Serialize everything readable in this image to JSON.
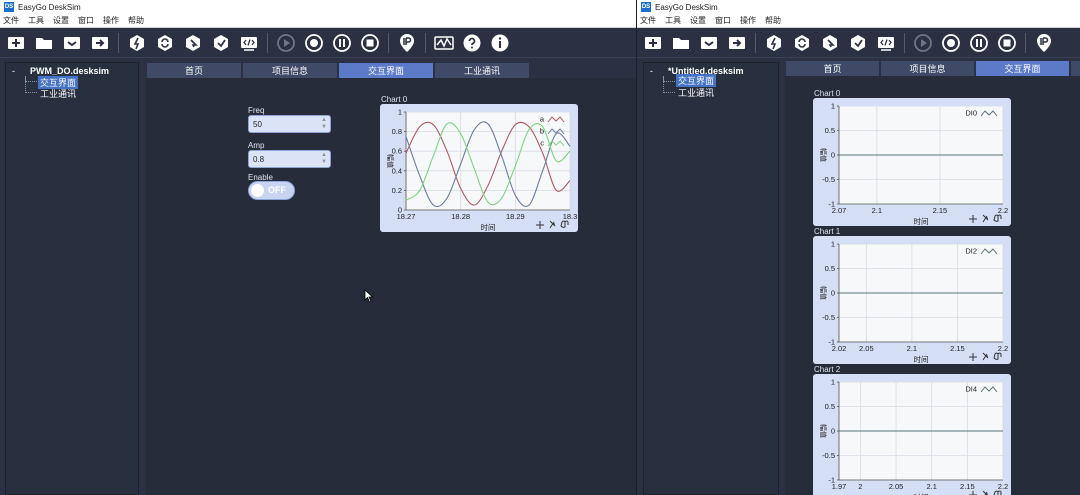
{
  "left": {
    "title": "EasyGo DeskSim",
    "app_icon": "DS",
    "menu": [
      "文件",
      "工具",
      "设置",
      "窗口",
      "操作",
      "帮助"
    ],
    "tree": {
      "root": "PWM_DO.desksim",
      "minus": "-",
      "items": [
        "交互界面",
        "工业通讯"
      ]
    },
    "tabs": [
      "首页",
      "项目信息",
      "交互界面",
      "工业通讯"
    ],
    "freq": {
      "label": "Freq",
      "value": "50"
    },
    "amp": {
      "label": "Amp",
      "value": "0.8"
    },
    "enable": {
      "label": "Enable",
      "state": "OFF"
    },
    "chart_caption": "Chart 0"
  },
  "right": {
    "title": "EasyGo DeskSim",
    "app_icon": "DS",
    "menu": [
      "文件",
      "工具",
      "设置",
      "窗口",
      "操作",
      "帮助"
    ],
    "tree": {
      "root": "*Untitled.desksim",
      "minus": "-",
      "items": [
        "交互界面",
        "工业通讯"
      ]
    },
    "tabs": [
      "首页",
      "项目信息",
      "交互界面"
    ],
    "chart_captions": [
      "Chart 0",
      "Chart 1",
      "Chart 2"
    ]
  },
  "colors": {
    "accent": "#5b7bc8",
    "series_a": "#b05a63",
    "series_b": "#6b7e9e",
    "series_c": "#7cd67c",
    "trace": "#5a7478"
  },
  "icons": [
    "new-icon",
    "open-icon",
    "save-icon",
    "export-icon",
    "build-icon",
    "refresh-icon",
    "download-icon",
    "deploy-icon",
    "code-icon",
    "play-icon",
    "record-icon",
    "pause-icon",
    "stop-icon",
    "ip-icon",
    "scope-icon",
    "help-icon",
    "info-icon"
  ],
  "chart_data": [
    {
      "type": "line",
      "title": "Chart 0",
      "xlabel": "时间",
      "ylabel": "幅值",
      "x": [
        18.27,
        18.2725,
        18.275,
        18.2775,
        18.28,
        18.2825,
        18.285,
        18.2875,
        18.29,
        18.2925,
        18.295,
        18.2975,
        18.3
      ],
      "series": [
        {
          "name": "a",
          "values": [
            0.58,
            0.85,
            0.87,
            0.6,
            0.22,
            0.05,
            0.25,
            0.6,
            0.87,
            0.85,
            0.58,
            0.2,
            0.3
          ]
        },
        {
          "name": "b",
          "values": [
            0.75,
            0.35,
            0.05,
            0.12,
            0.47,
            0.82,
            0.88,
            0.55,
            0.15,
            0.05,
            0.4,
            0.78,
            0.65
          ]
        },
        {
          "name": "c",
          "values": [
            0.1,
            0.2,
            0.55,
            0.88,
            0.78,
            0.42,
            0.08,
            0.12,
            0.45,
            0.82,
            0.85,
            0.5,
            0.6
          ]
        }
      ],
      "xticks": [
        "18.27",
        "18.28",
        "18.29",
        "18.3"
      ],
      "yticks": [
        "0",
        "0.2",
        "0.4",
        "0.6",
        "0.8",
        "1"
      ],
      "xlim": [
        18.27,
        18.3
      ],
      "ylim": [
        0,
        1
      ],
      "grid": true,
      "legend": "top-right"
    },
    {
      "type": "line",
      "title": "Chart 0",
      "xlabel": "时间",
      "ylabel": "幅值",
      "x": [
        2.07,
        2.2
      ],
      "series": [
        {
          "name": "DI0",
          "values": [
            0,
            0
          ]
        }
      ],
      "xticks": [
        "2.07",
        "2.1",
        "2.15",
        "2.2"
      ],
      "yticks": [
        "-1",
        "-0.5",
        "0",
        "0.5",
        "1"
      ],
      "xlim": [
        2.07,
        2.2
      ],
      "ylim": [
        -1,
        1
      ],
      "grid": true,
      "legend": "top-right"
    },
    {
      "type": "line",
      "title": "Chart 1",
      "xlabel": "时间",
      "ylabel": "幅值",
      "x": [
        2.02,
        2.2
      ],
      "series": [
        {
          "name": "DI2",
          "values": [
            0,
            0
          ]
        }
      ],
      "xticks": [
        "2.02",
        "2.05",
        "2.1",
        "2.15",
        "2.2"
      ],
      "yticks": [
        "-1",
        "-0.5",
        "0",
        "0.5",
        "1"
      ],
      "xlim": [
        2.02,
        2.2
      ],
      "ylim": [
        -1,
        1
      ],
      "grid": true,
      "legend": "top-right"
    },
    {
      "type": "line",
      "title": "Chart 2",
      "xlabel": "时间",
      "ylabel": "幅值",
      "x": [
        1.97,
        2.2
      ],
      "series": [
        {
          "name": "DI4",
          "values": [
            0,
            0
          ]
        }
      ],
      "xticks": [
        "1.97",
        "2",
        "2.05",
        "2.1",
        "2.15",
        "2.2"
      ],
      "yticks": [
        "-1",
        "-0.5",
        "0",
        "0.5",
        "1"
      ],
      "xlim": [
        1.97,
        2.2
      ],
      "ylim": [
        -1,
        1
      ],
      "grid": true,
      "legend": "top-right"
    }
  ]
}
